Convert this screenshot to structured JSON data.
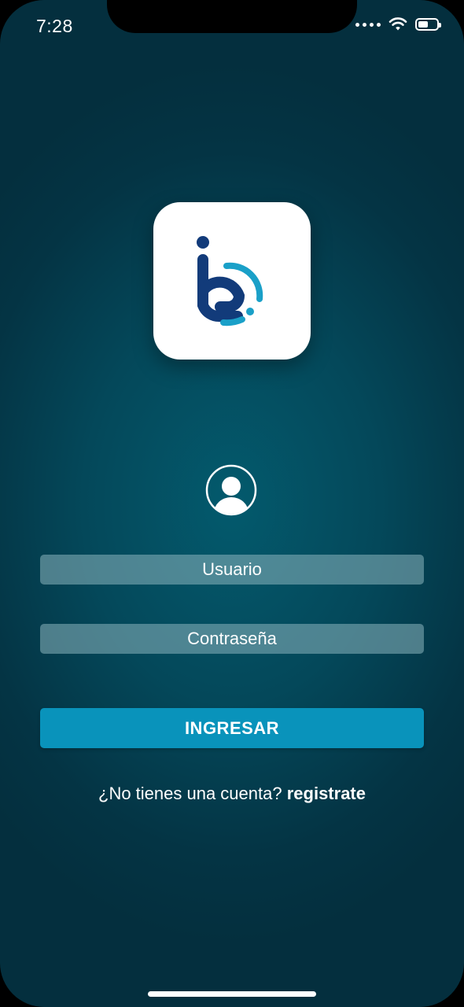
{
  "status_bar": {
    "time": "7:28",
    "battery_level": 0.55
  },
  "app_icon": {
    "name": "app-logo-icon"
  },
  "form": {
    "username_placeholder": "Usuario",
    "password_placeholder": "Contraseña",
    "login_label": "INGRESAR"
  },
  "signup": {
    "prompt": "¿No tienes una cuenta? ",
    "link_label": "registrate"
  },
  "colors": {
    "background": "#04485a",
    "button": "#0993bb",
    "logo_dark": "#123b7a",
    "logo_light": "#1aa0c8"
  }
}
